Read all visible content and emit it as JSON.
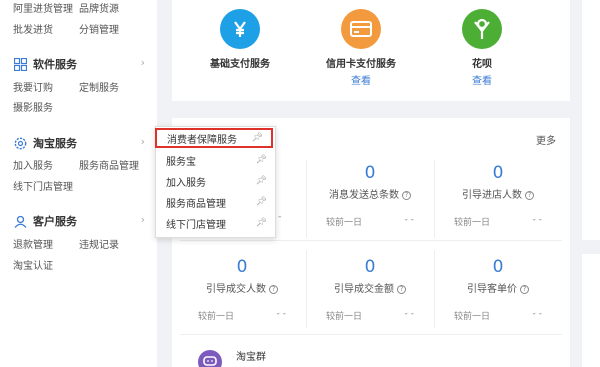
{
  "sidebar": {
    "row1": [
      "阿里进货管理",
      "品牌货源"
    ],
    "row2": [
      "批发进货",
      "分销管理"
    ],
    "software": {
      "title": "软件服务",
      "row1": [
        "我要订购",
        "定制服务"
      ],
      "row2": [
        "摄影服务"
      ]
    },
    "taobao": {
      "title": "淘宝服务",
      "row1": [
        "加入服务",
        "服务商品管理"
      ],
      "row2": [
        "线下门店管理"
      ]
    },
    "customer": {
      "title": "客户服务",
      "row1": [
        "退款管理",
        "违规记录"
      ],
      "row2": [
        "淘宝认证"
      ]
    }
  },
  "services": [
    {
      "name": "基础支付服务",
      "link": "",
      "color": "#1ea0e6",
      "icon": "yen-icon"
    },
    {
      "name": "信用卡支付服务",
      "link": "查看",
      "color": "#f39a3f",
      "icon": "credit-card-icon"
    },
    {
      "name": "花呗",
      "link": "查看",
      "color": "#4cae35",
      "icon": "huabei-icon"
    }
  ],
  "more_label": "更多",
  "stats_row1": [
    {
      "value": "0",
      "label": "消息发送总条数",
      "cmp_label": "较前一日",
      "cmp_value": "- -"
    },
    {
      "value": "0",
      "label": "引导进店人数",
      "cmp_label": "较前一日",
      "cmp_value": "- -"
    }
  ],
  "stats_row1_hidden_cmp": "- -",
  "stats_row2": [
    {
      "value": "0",
      "label": "引导成交人数",
      "cmp_label": "较前一日",
      "cmp_value": "- -"
    },
    {
      "value": "0",
      "label": "引导成交金额",
      "cmp_label": "较前一日",
      "cmp_value": "- -"
    },
    {
      "value": "0",
      "label": "引导客单价",
      "cmp_label": "较前一日",
      "cmp_value": "- -"
    }
  ],
  "group": {
    "name": "淘宝群"
  },
  "popup": [
    {
      "label": "消费者保障服务",
      "highlighted": true
    },
    {
      "label": "服务宝",
      "highlighted": false
    },
    {
      "label": "加入服务",
      "highlighted": false
    },
    {
      "label": "服务商品管理",
      "highlighted": false
    },
    {
      "label": "线下门店管理",
      "highlighted": false
    }
  ],
  "accent_color": "#3a7bd5",
  "highlight_color": "#e0302a"
}
